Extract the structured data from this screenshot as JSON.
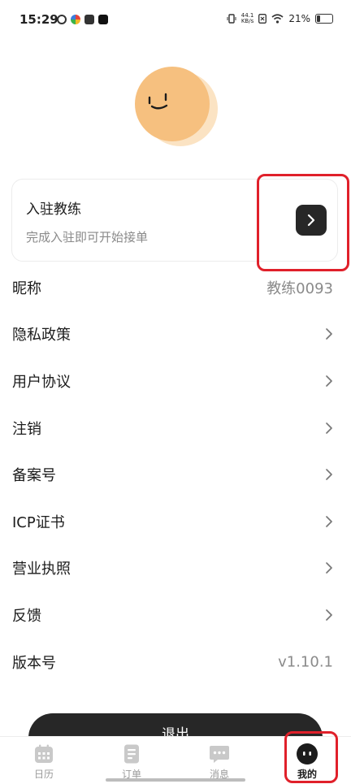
{
  "status_bar": {
    "time": "15:29",
    "net_speed_value": "44.1",
    "net_speed_unit": "KB/s",
    "battery": "21%",
    "battery_level": 0.21
  },
  "join_card": {
    "title": "入驻教练",
    "subtitle": "完成入驻即可开始接单"
  },
  "menu": {
    "items": [
      {
        "label": "昵称",
        "value": "教练0093"
      },
      {
        "label": "隐私政策"
      },
      {
        "label": "用户协议"
      },
      {
        "label": "注销"
      },
      {
        "label": "备案号"
      },
      {
        "label": "ICP证书"
      },
      {
        "label": "营业执照"
      },
      {
        "label": "反馈"
      },
      {
        "label": "版本号",
        "value": "v1.10.1"
      }
    ]
  },
  "logout_label": "退出",
  "tabs": [
    {
      "label": "日历",
      "icon": "calendar-icon"
    },
    {
      "label": "订单",
      "icon": "document-icon"
    },
    {
      "label": "消息",
      "icon": "chat-icon"
    },
    {
      "label": "我的",
      "icon": "face-icon",
      "active": true
    }
  ],
  "colors": {
    "accent_dark": "#272727",
    "avatar": "#f6c07f",
    "highlight": "#e0202a"
  }
}
